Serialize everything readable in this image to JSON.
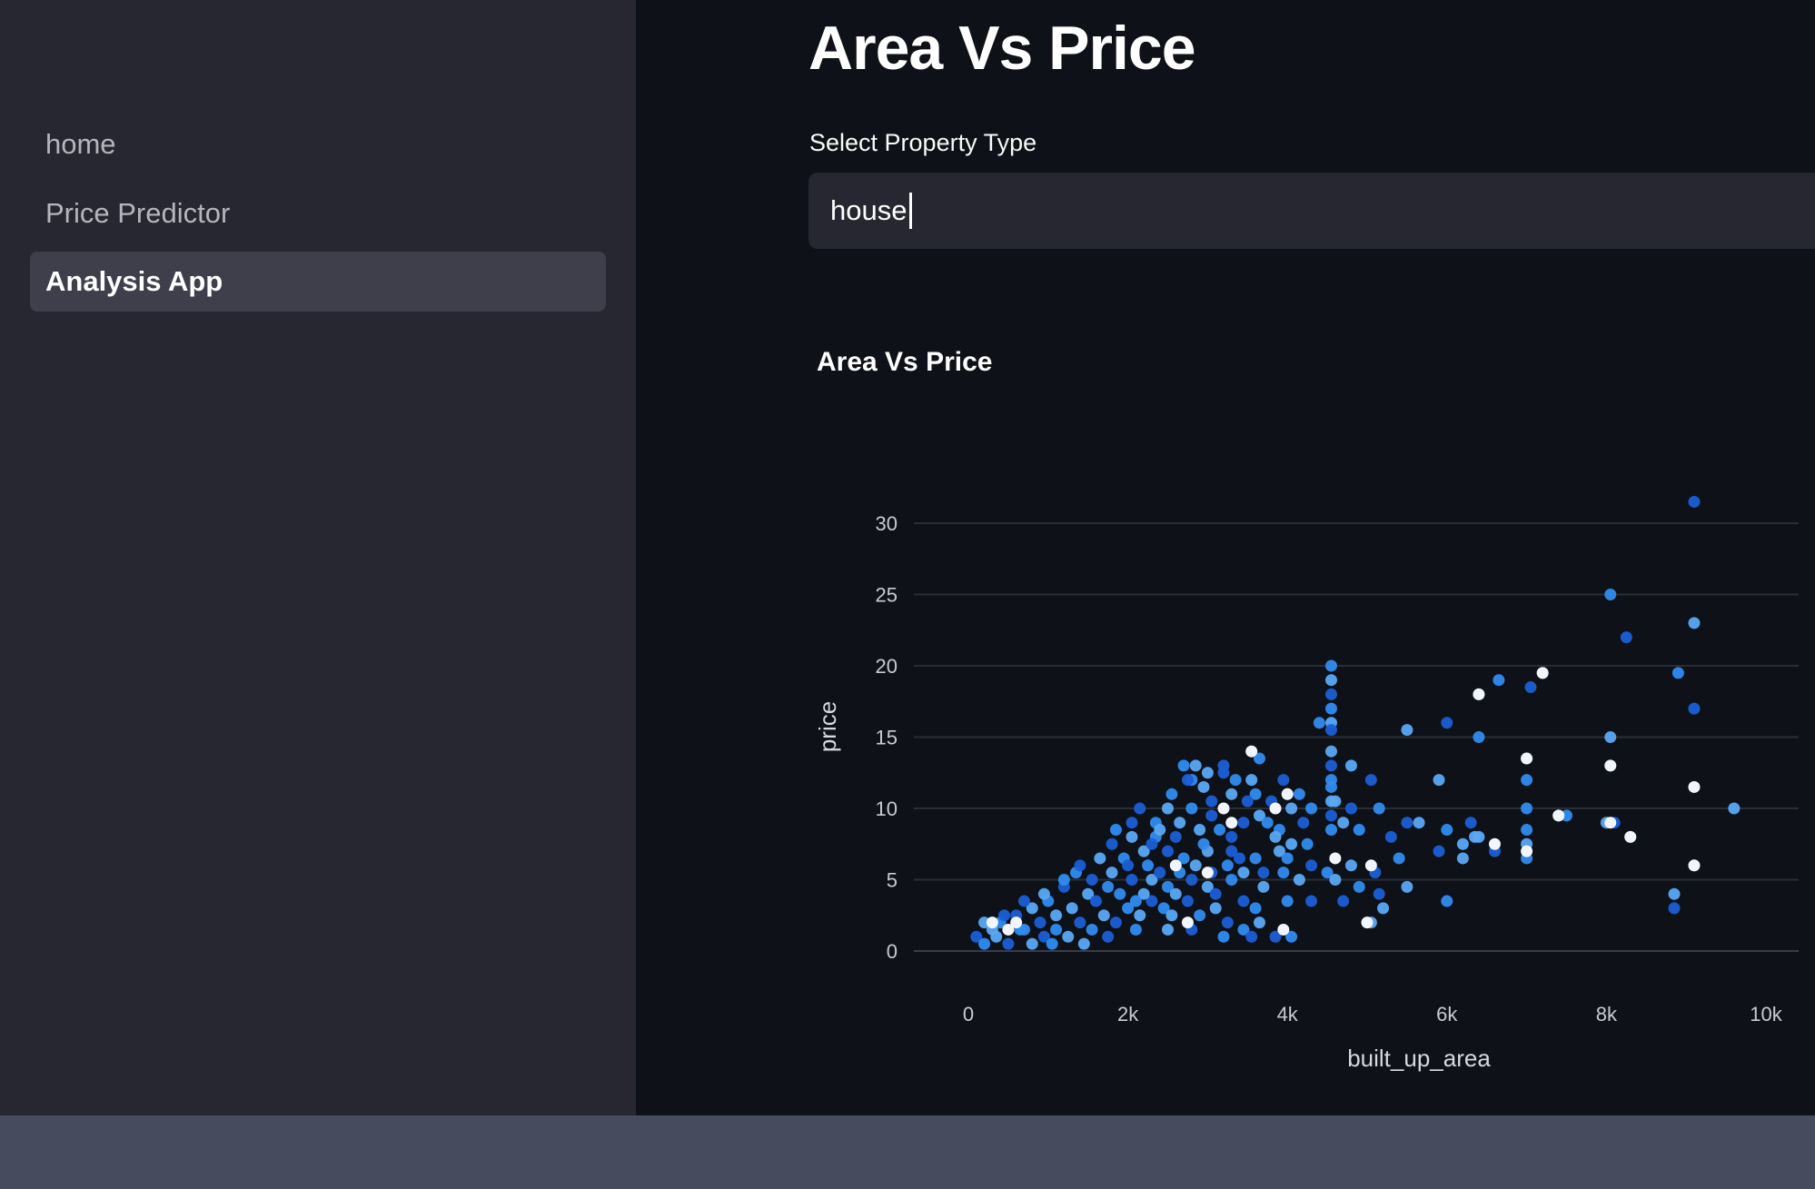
{
  "sidebar": {
    "items": [
      {
        "label": "home",
        "active": false
      },
      {
        "label": "Price Predictor",
        "active": false
      },
      {
        "label": "Analysis App",
        "active": true
      }
    ]
  },
  "main": {
    "title": "Area Vs Price",
    "select": {
      "label": "Select Property Type",
      "value": "house"
    }
  },
  "colors": {
    "app_background": "#0e1117",
    "sidebar_background": "#262730",
    "active_nav": "#3e3f4b",
    "point_dark": "#1a5fd6",
    "point_mid": "#2f8cf0",
    "point_light": "#5aa9f5",
    "point_white": "#f2f5fb",
    "bottom_bar": "#464c5e"
  },
  "chart_data": {
    "type": "scatter",
    "title": "Area Vs Price",
    "xlabel": "built_up_area",
    "ylabel": "price",
    "xlim": [
      0,
      10000
    ],
    "ylim": [
      0,
      30
    ],
    "xticks": [
      0,
      2000,
      4000,
      6000,
      8000,
      10000
    ],
    "xtick_labels": [
      "0",
      "2k",
      "4k",
      "6k",
      "8k",
      "10k"
    ],
    "yticks": [
      0,
      5,
      10,
      15,
      20,
      25,
      30
    ],
    "ytick_labels": [
      "0",
      "5",
      "10",
      "15",
      "20",
      "25",
      "30"
    ],
    "grid": true,
    "color_scale": "blue-to-white",
    "points": [
      [
        9100,
        31.5
      ],
      [
        8050,
        25
      ],
      [
        9100,
        23
      ],
      [
        8250,
        22
      ],
      [
        8900,
        19.5
      ],
      [
        7200,
        19.5
      ],
      [
        7050,
        18.5
      ],
      [
        6650,
        19
      ],
      [
        6400,
        18
      ],
      [
        9100,
        17
      ],
      [
        4550,
        20
      ],
      [
        4550,
        19
      ],
      [
        4550,
        18
      ],
      [
        4550,
        17
      ],
      [
        4550,
        16
      ],
      [
        4550,
        15.5
      ],
      [
        4400,
        16
      ],
      [
        5500,
        15.5
      ],
      [
        6000,
        16
      ],
      [
        6400,
        15
      ],
      [
        8050,
        15
      ],
      [
        3550,
        14
      ],
      [
        3650,
        13.5
      ],
      [
        7000,
        13.5
      ],
      [
        8050,
        13
      ],
      [
        2700,
        13
      ],
      [
        2850,
        13
      ],
      [
        3200,
        12.5
      ],
      [
        3350,
        12
      ],
      [
        4800,
        13
      ],
      [
        5050,
        12
      ],
      [
        4550,
        12
      ],
      [
        5900,
        12
      ],
      [
        9100,
        11.5
      ],
      [
        7000,
        12
      ],
      [
        4000,
        11
      ],
      [
        3800,
        10.5
      ],
      [
        3600,
        11
      ],
      [
        3300,
        11
      ],
      [
        3050,
        10.5
      ],
      [
        2800,
        10
      ],
      [
        2500,
        10
      ],
      [
        2150,
        10
      ],
      [
        4300,
        10
      ],
      [
        4600,
        10.5
      ],
      [
        4800,
        10
      ],
      [
        5150,
        10
      ],
      [
        9600,
        10
      ],
      [
        7400,
        9.5
      ],
      [
        7500,
        9.5
      ],
      [
        8000,
        9
      ],
      [
        8100,
        9
      ],
      [
        8300,
        8
      ],
      [
        6400,
        8
      ],
      [
        5500,
        9
      ],
      [
        7000,
        8.5
      ],
      [
        7000,
        7.5
      ],
      [
        5300,
        8
      ],
      [
        4900,
        8.5
      ],
      [
        4700,
        9
      ],
      [
        4200,
        9
      ],
      [
        3900,
        8.5
      ],
      [
        3650,
        9.5
      ],
      [
        3450,
        9
      ],
      [
        3150,
        8.5
      ],
      [
        2900,
        8.5
      ],
      [
        2600,
        8
      ],
      [
        2350,
        8
      ],
      [
        2050,
        8
      ],
      [
        1800,
        7.5
      ],
      [
        1950,
        6.5
      ],
      [
        2200,
        7
      ],
      [
        2500,
        7
      ],
      [
        2700,
        6.5
      ],
      [
        3000,
        7
      ],
      [
        3300,
        7
      ],
      [
        3600,
        6.5
      ],
      [
        3900,
        7
      ],
      [
        4300,
        6
      ],
      [
        4500,
        5.5
      ],
      [
        4800,
        6
      ],
      [
        5100,
        5.5
      ],
      [
        5400,
        6.5
      ],
      [
        6200,
        6.5
      ],
      [
        6600,
        7
      ],
      [
        7000,
        6.5
      ],
      [
        6200,
        7.5
      ],
      [
        5900,
        7
      ],
      [
        9100,
        6
      ],
      [
        8850,
        4
      ],
      [
        8850,
        3
      ],
      [
        6000,
        3.5
      ],
      [
        5500,
        4.5
      ],
      [
        5150,
        4
      ],
      [
        4900,
        4.5
      ],
      [
        4600,
        5
      ],
      [
        4300,
        3.5
      ],
      [
        4000,
        3.5
      ],
      [
        3700,
        4.5
      ],
      [
        3450,
        3.5
      ],
      [
        3300,
        5
      ],
      [
        3000,
        4.5
      ],
      [
        2800,
        5
      ],
      [
        2500,
        4.5
      ],
      [
        2300,
        5
      ],
      [
        2050,
        5
      ],
      [
        1750,
        4.5
      ],
      [
        1500,
        4
      ],
      [
        1200,
        4.5
      ],
      [
        1000,
        3.5
      ],
      [
        800,
        3
      ],
      [
        600,
        2.5
      ],
      [
        400,
        2
      ],
      [
        200,
        2
      ],
      [
        100,
        1
      ],
      [
        200,
        0.5
      ],
      [
        350,
        1
      ],
      [
        500,
        0.5
      ],
      [
        650,
        1.5
      ],
      [
        800,
        0.5
      ],
      [
        950,
        1
      ],
      [
        1100,
        1.5
      ],
      [
        1250,
        1
      ],
      [
        1400,
        2
      ],
      [
        1550,
        1.5
      ],
      [
        1700,
        2.5
      ],
      [
        1850,
        2
      ],
      [
        2000,
        3
      ],
      [
        2150,
        2.5
      ],
      [
        2300,
        3.5
      ],
      [
        2450,
        3
      ],
      [
        2600,
        4
      ],
      [
        2750,
        3.5
      ],
      [
        2900,
        2.5
      ],
      [
        3100,
        3
      ],
      [
        3250,
        2
      ],
      [
        3450,
        1.5
      ],
      [
        3650,
        2
      ],
      [
        3850,
        1
      ],
      [
        4050,
        1
      ],
      [
        1300,
        3
      ],
      [
        1600,
        3.5
      ],
      [
        1900,
        4
      ],
      [
        2200,
        4
      ],
      [
        2400,
        5.5
      ],
      [
        2650,
        5.5
      ],
      [
        2850,
        6
      ],
      [
        3050,
        5.5
      ],
      [
        3250,
        6
      ],
      [
        3450,
        5.5
      ],
      [
        3700,
        5.5
      ],
      [
        3950,
        5.5
      ],
      [
        4150,
        5
      ],
      [
        2000,
        6
      ],
      [
        2250,
        6
      ],
      [
        1800,
        5.5
      ],
      [
        1550,
        5
      ],
      [
        1350,
        5.5
      ],
      [
        1100,
        2.5
      ],
      [
        900,
        2
      ],
      [
        700,
        1.5
      ],
      [
        300,
        1.5
      ],
      [
        450,
        2.5
      ],
      [
        1050,
        0.5
      ],
      [
        1450,
        0.5
      ],
      [
        1750,
        1
      ],
      [
        2100,
        1.5
      ],
      [
        2500,
        1.5
      ],
      [
        2800,
        1.5
      ],
      [
        3200,
        1
      ],
      [
        5050,
        2
      ],
      [
        3550,
        1
      ],
      [
        2800,
        12
      ],
      [
        3000,
        12.5
      ],
      [
        3200,
        13
      ],
      [
        2550,
        11
      ],
      [
        2950,
        11.5
      ],
      [
        3500,
        10.5
      ],
      [
        3750,
        9
      ],
      [
        4050,
        10
      ],
      [
        3950,
        12
      ],
      [
        4150,
        11
      ],
      [
        5650,
        9
      ],
      [
        6300,
        9
      ],
      [
        7000,
        10
      ],
      [
        4550,
        14
      ],
      [
        4550,
        13
      ],
      [
        4550,
        11.5
      ],
      [
        4550,
        10.5
      ],
      [
        4550,
        9.5
      ],
      [
        4550,
        8.5
      ],
      [
        3850,
        8
      ],
      [
        3050,
        9.5
      ],
      [
        2350,
        9
      ],
      [
        2650,
        9
      ],
      [
        2050,
        9
      ],
      [
        1850,
        8.5
      ],
      [
        3550,
        12
      ],
      [
        2750,
        12
      ],
      [
        4000,
        6.5
      ],
      [
        1650,
        6.5
      ],
      [
        1400,
        6
      ],
      [
        1200,
        5
      ],
      [
        950,
        4
      ],
      [
        700,
        3.5
      ],
      [
        2100,
        3.5
      ],
      [
        2550,
        2.5
      ],
      [
        3100,
        4
      ],
      [
        3600,
        3
      ],
      [
        5200,
        3
      ],
      [
        4700,
        3.5
      ],
      [
        6000,
        8.5
      ],
      [
        6350,
        8
      ],
      [
        3300,
        8
      ],
      [
        2950,
        7.5
      ],
      [
        2400,
        8.5
      ],
      [
        2300,
        7.5
      ],
      [
        4250,
        7.5
      ],
      [
        4050,
        7.5
      ],
      [
        3400,
        6.5
      ]
    ],
    "highlight_points": [
      [
        3550,
        14
      ],
      [
        6400,
        18
      ],
      [
        7200,
        19.5
      ],
      [
        8050,
        13
      ],
      [
        7000,
        13.5
      ],
      [
        9100,
        11.5
      ],
      [
        8050,
        9
      ],
      [
        8300,
        8
      ],
      [
        7000,
        7
      ],
      [
        9100,
        6
      ],
      [
        7400,
        9.5
      ],
      [
        6600,
        7.5
      ],
      [
        4000,
        11
      ],
      [
        3850,
        10
      ],
      [
        3200,
        10
      ],
      [
        3300,
        9
      ],
      [
        2600,
        6
      ],
      [
        3000,
        5.5
      ],
      [
        4600,
        6.5
      ],
      [
        5050,
        6
      ],
      [
        5000,
        2
      ],
      [
        3950,
        1.5
      ],
      [
        2750,
        2
      ],
      [
        500,
        1.5
      ],
      [
        300,
        2
      ],
      [
        600,
        2
      ]
    ]
  }
}
